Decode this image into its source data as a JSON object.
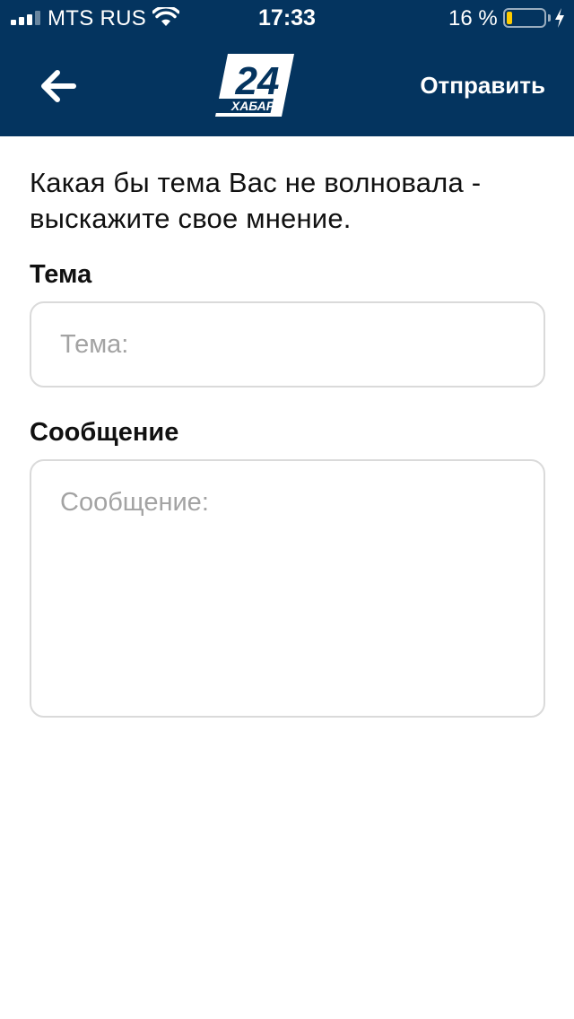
{
  "status_bar": {
    "carrier": "MTS RUS",
    "time": "17:33",
    "battery_percent_label": "16 %",
    "battery_level": 0.16,
    "signal_bars_active": 3
  },
  "nav": {
    "back_icon": "arrow-left-icon",
    "logo_number": "24",
    "logo_text": "ХАБАР",
    "send_label": "Отправить"
  },
  "form": {
    "intro": "Какая бы тема Вас не волновала - выскажите свое мнение.",
    "topic": {
      "label": "Тема",
      "value": "",
      "placeholder": "Тема:"
    },
    "message": {
      "label": "Сообщение",
      "value": "",
      "placeholder": "Сообщение:"
    }
  },
  "colors": {
    "header_bg": "#04345f",
    "battery_fill": "#ffcc00",
    "field_border": "#dadada",
    "placeholder": "#a3a3a3"
  }
}
